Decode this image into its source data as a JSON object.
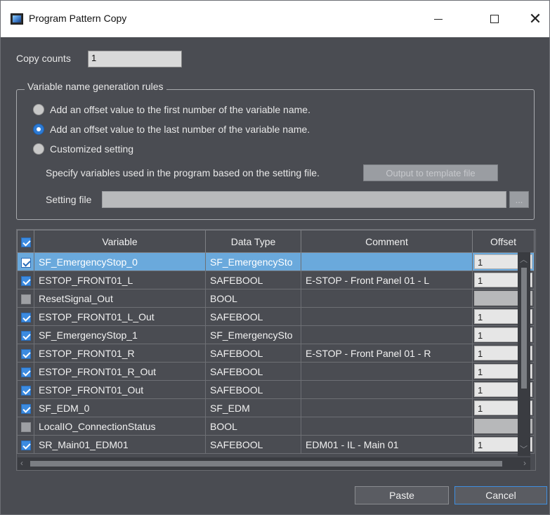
{
  "window": {
    "title": "Program Pattern Copy",
    "controls": {
      "minimize": "—",
      "maximize": "☐",
      "close": "✕"
    }
  },
  "copy_counts": {
    "label": "Copy counts",
    "value": "1"
  },
  "rules": {
    "legend": "Variable name generation rules",
    "options": [
      {
        "label": "Add an offset value to the first number of the variable name.",
        "selected": false
      },
      {
        "label": "Add an offset value to the last number of the variable name.",
        "selected": true
      },
      {
        "label": "Customized setting",
        "selected": false
      }
    ],
    "specify_text": "Specify variables used in the program based on the setting file.",
    "output_button": "Output to template file",
    "setting_file_label": "Setting file",
    "setting_file_value": "",
    "browse_button": "..."
  },
  "table": {
    "columns": [
      "Variable",
      "Data Type",
      "Comment",
      "Offset"
    ],
    "rows": [
      {
        "checked": true,
        "variable": "SF_EmergencyStop_0",
        "type": "SF_EmergencySto",
        "comment": "",
        "offset": "1"
      },
      {
        "checked": true,
        "variable": "ESTOP_FRONT01_L",
        "type": "SAFEBOOL",
        "comment": "E-STOP - Front Panel 01 - L",
        "offset": "1"
      },
      {
        "checked": false,
        "variable": "ResetSignal_Out",
        "type": "BOOL",
        "comment": "",
        "offset": ""
      },
      {
        "checked": true,
        "variable": "ESTOP_FRONT01_L_Out",
        "type": "SAFEBOOL",
        "comment": "",
        "offset": "1"
      },
      {
        "checked": true,
        "variable": "SF_EmergencyStop_1",
        "type": "SF_EmergencySto",
        "comment": "",
        "offset": "1"
      },
      {
        "checked": true,
        "variable": "ESTOP_FRONT01_R",
        "type": "SAFEBOOL",
        "comment": "E-STOP - Front Panel 01 - R",
        "offset": "1"
      },
      {
        "checked": true,
        "variable": "ESTOP_FRONT01_R_Out",
        "type": "SAFEBOOL",
        "comment": "",
        "offset": "1"
      },
      {
        "checked": true,
        "variable": "ESTOP_FRONT01_Out",
        "type": "SAFEBOOL",
        "comment": "",
        "offset": "1"
      },
      {
        "checked": true,
        "variable": "SF_EDM_0",
        "type": "SF_EDM",
        "comment": "",
        "offset": "1"
      },
      {
        "checked": false,
        "variable": "LocalIO_ConnectionStatus",
        "type": "BOOL",
        "comment": "",
        "offset": ""
      },
      {
        "checked": true,
        "variable": "SR_Main01_EDM01",
        "type": "SAFEBOOL",
        "comment": "EDM01 - IL - Main 01",
        "offset": "1"
      }
    ]
  },
  "buttons": {
    "paste": "Paste",
    "cancel": "Cancel"
  }
}
